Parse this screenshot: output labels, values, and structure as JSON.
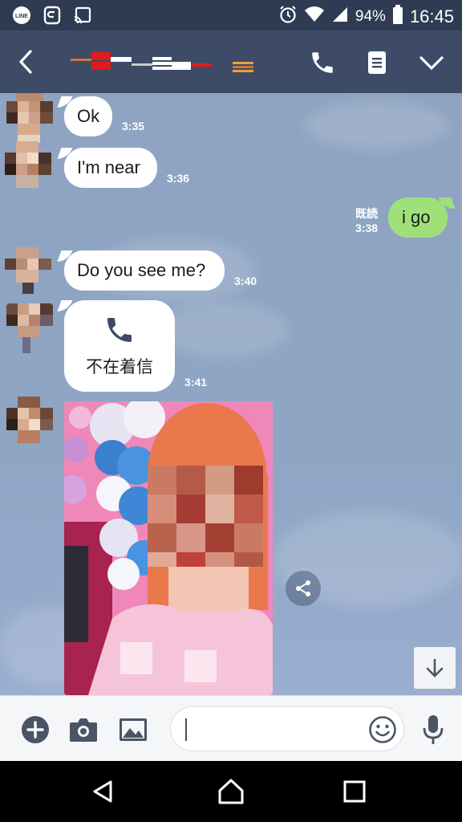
{
  "status_bar": {
    "battery_percent": "94%",
    "clock": "16:45",
    "left_icons": [
      "line-app-icon",
      "sync-icon",
      "cast-icon"
    ],
    "right_icons": [
      "alarm-icon",
      "wifi-icon",
      "signal-icon",
      "battery-icon"
    ]
  },
  "header": {
    "back_icon": "chevron-left-icon",
    "title_redacted": true,
    "actions": [
      "phone-icon",
      "notes-icon",
      "chevron-down-icon"
    ]
  },
  "messages": [
    {
      "side": "in",
      "text": "Ok",
      "time": "3:35"
    },
    {
      "side": "in",
      "text": "I'm near",
      "time": "3:36"
    },
    {
      "side": "out",
      "text": "i go",
      "read_status": "既読",
      "time": "3:38"
    },
    {
      "side": "in",
      "text": "Do you see me?",
      "time": "3:40"
    },
    {
      "side": "in",
      "type": "call",
      "text": "不在着信",
      "time": "3:41"
    },
    {
      "side": "in",
      "type": "photo"
    }
  ],
  "input_bar": {
    "placeholder": "",
    "icons": [
      "plus-icon",
      "camera-icon",
      "image-icon",
      "emoji-icon",
      "mic-icon"
    ]
  },
  "nav_bar": {
    "icons": [
      "back-triangle-icon",
      "home-icon",
      "recents-icon"
    ]
  },
  "colors": {
    "status_bg": "#2e3b52",
    "header_bg": "#3d4b66",
    "chat_bg": "#8ea5c4",
    "outgoing_bubble": "#9fe07a",
    "incoming_bubble": "#ffffff",
    "call_icon": "#3d4b66"
  }
}
